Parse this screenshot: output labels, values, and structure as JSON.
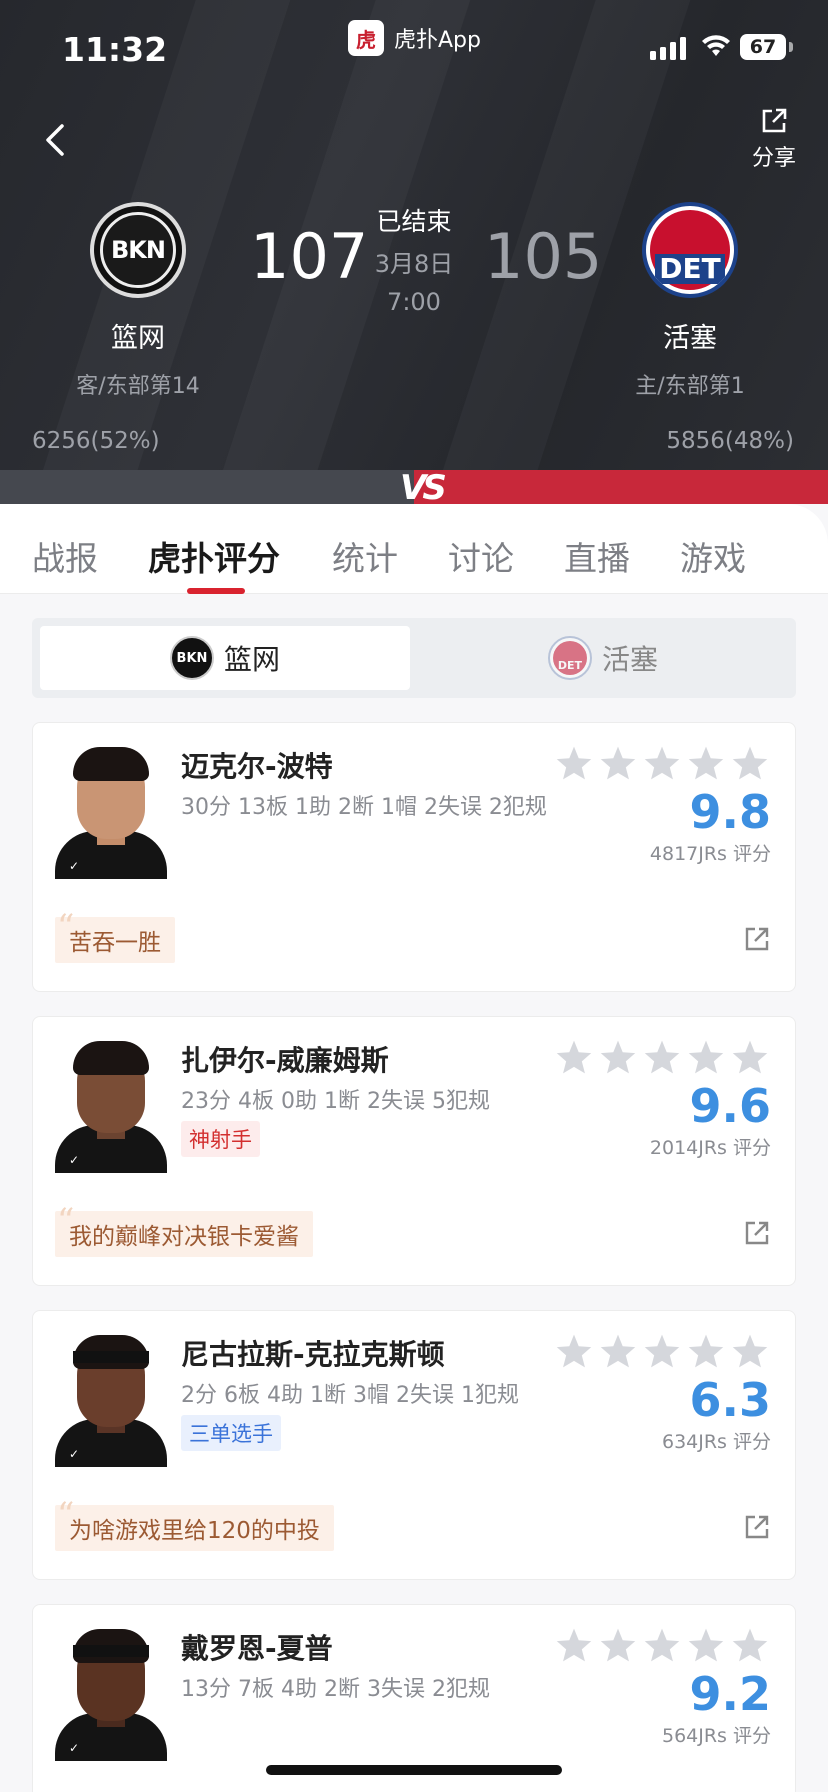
{
  "status_bar": {
    "time": "11:32",
    "app_name": "虎扑App",
    "app_logo_text": "虎",
    "battery": "67"
  },
  "header": {
    "share_label": "分享",
    "game_status": "已结束",
    "game_date": "3月8日",
    "game_time": "7:00",
    "home_team": {
      "name": "篮网",
      "logo_text": "BKN",
      "sub": "客/东部第14",
      "score": "107",
      "support": "6256(52%)"
    },
    "away_team": {
      "name": "活塞",
      "logo_text": "DET",
      "sub": "主/东部第1",
      "score": "105",
      "support": "5856(48%)"
    },
    "vs_text": "VS"
  },
  "tabs": [
    {
      "label": "战报"
    },
    {
      "label": "虎扑评分"
    },
    {
      "label": "统计"
    },
    {
      "label": "讨论"
    },
    {
      "label": "直播"
    },
    {
      "label": "游戏"
    }
  ],
  "active_tab": "虎扑评分",
  "team_toggle": {
    "left": {
      "label": "篮网",
      "logo_text": "BKN"
    },
    "right": {
      "label": "活塞",
      "logo_text": "DET"
    }
  },
  "players": [
    {
      "name": "迈克尔-波特",
      "stats": "30分 13板 1助 2断 1帽 2失误 2犯规",
      "tag": "",
      "rating": "9.8",
      "votes": "4817JRs 评分",
      "comment": "苦吞一胜"
    },
    {
      "name": "扎伊尔-威廉姆斯",
      "stats": "23分 4板 0助 1断 2失误 5犯规",
      "tag": "神射手",
      "rating": "9.6",
      "votes": "2014JRs 评分",
      "comment": "我的巅峰对决银卡爱酱"
    },
    {
      "name": "尼古拉斯-克拉克斯顿",
      "stats": "2分 6板 4助 1断 3帽 2失误 1犯规",
      "tag": "三单选手",
      "rating": "6.3",
      "votes": "634JRs 评分",
      "comment": "为啥游戏里给120的中投"
    },
    {
      "name": "戴罗恩-夏普",
      "stats": "13分 7板 4助 2断 3失误 2犯规",
      "tag": "",
      "rating": "9.2",
      "votes": "564JRs 评分",
      "comment": ""
    }
  ],
  "colors": {
    "accent_red": "#d9232f",
    "rating_blue": "#3d8fe0",
    "header_bg": "#2a2c31"
  }
}
